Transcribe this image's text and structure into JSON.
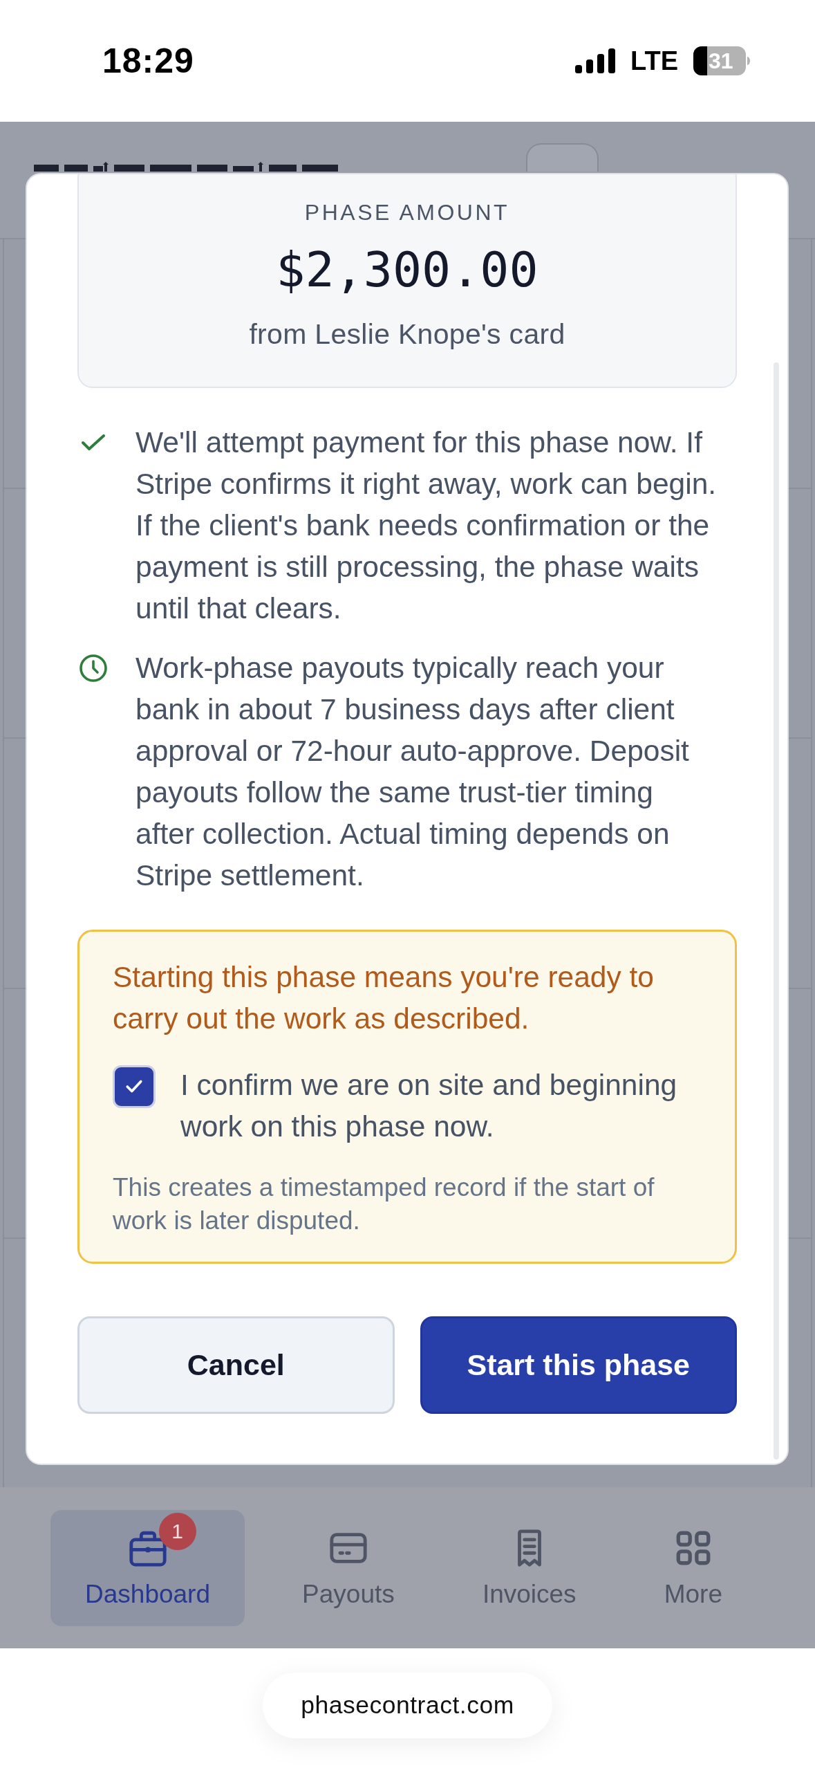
{
  "status_bar": {
    "time": "18:29",
    "network": "LTE",
    "battery": "31"
  },
  "modal": {
    "amount_card": {
      "label": "PHASE AMOUNT",
      "amount": "$2,300.00",
      "source": "from Leslie Knope's card"
    },
    "notes": [
      {
        "kind": "check",
        "text": "We'll attempt payment for this phase now. If Stripe confirms it right away, work can begin. If the client's bank needs confirmation or the payment is still processing, the phase waits until that clears."
      },
      {
        "kind": "clock",
        "text": "Work-phase payouts typically reach your bank in about 7 business days after client approval or 72-hour auto-approve. Deposit payouts follow the same trust-tier timing after collection. Actual timing depends on Stripe settlement."
      }
    ],
    "warning": {
      "message": "Starting this phase means you're ready to carry out the work as described.",
      "confirm": {
        "label": "I confirm we are on site and beginning work on this phase now.",
        "checked": true
      },
      "note": "This creates a timestamped record if the start of work is later disputed."
    },
    "buttons": [
      {
        "kind": "secondary",
        "label": "Cancel"
      },
      {
        "kind": "primary",
        "label": "Start this phase"
      }
    ]
  },
  "bottom_nav": [
    {
      "kind": "briefcase",
      "label": "Dashboard",
      "selected": true,
      "badge": "1"
    },
    {
      "kind": "card",
      "label": "Payouts",
      "selected": false
    },
    {
      "kind": "receipt",
      "label": "Invoices",
      "selected": false
    },
    {
      "kind": "grid",
      "label": "More",
      "selected": false
    }
  ],
  "browser": {
    "url": "phasecontract.com"
  }
}
